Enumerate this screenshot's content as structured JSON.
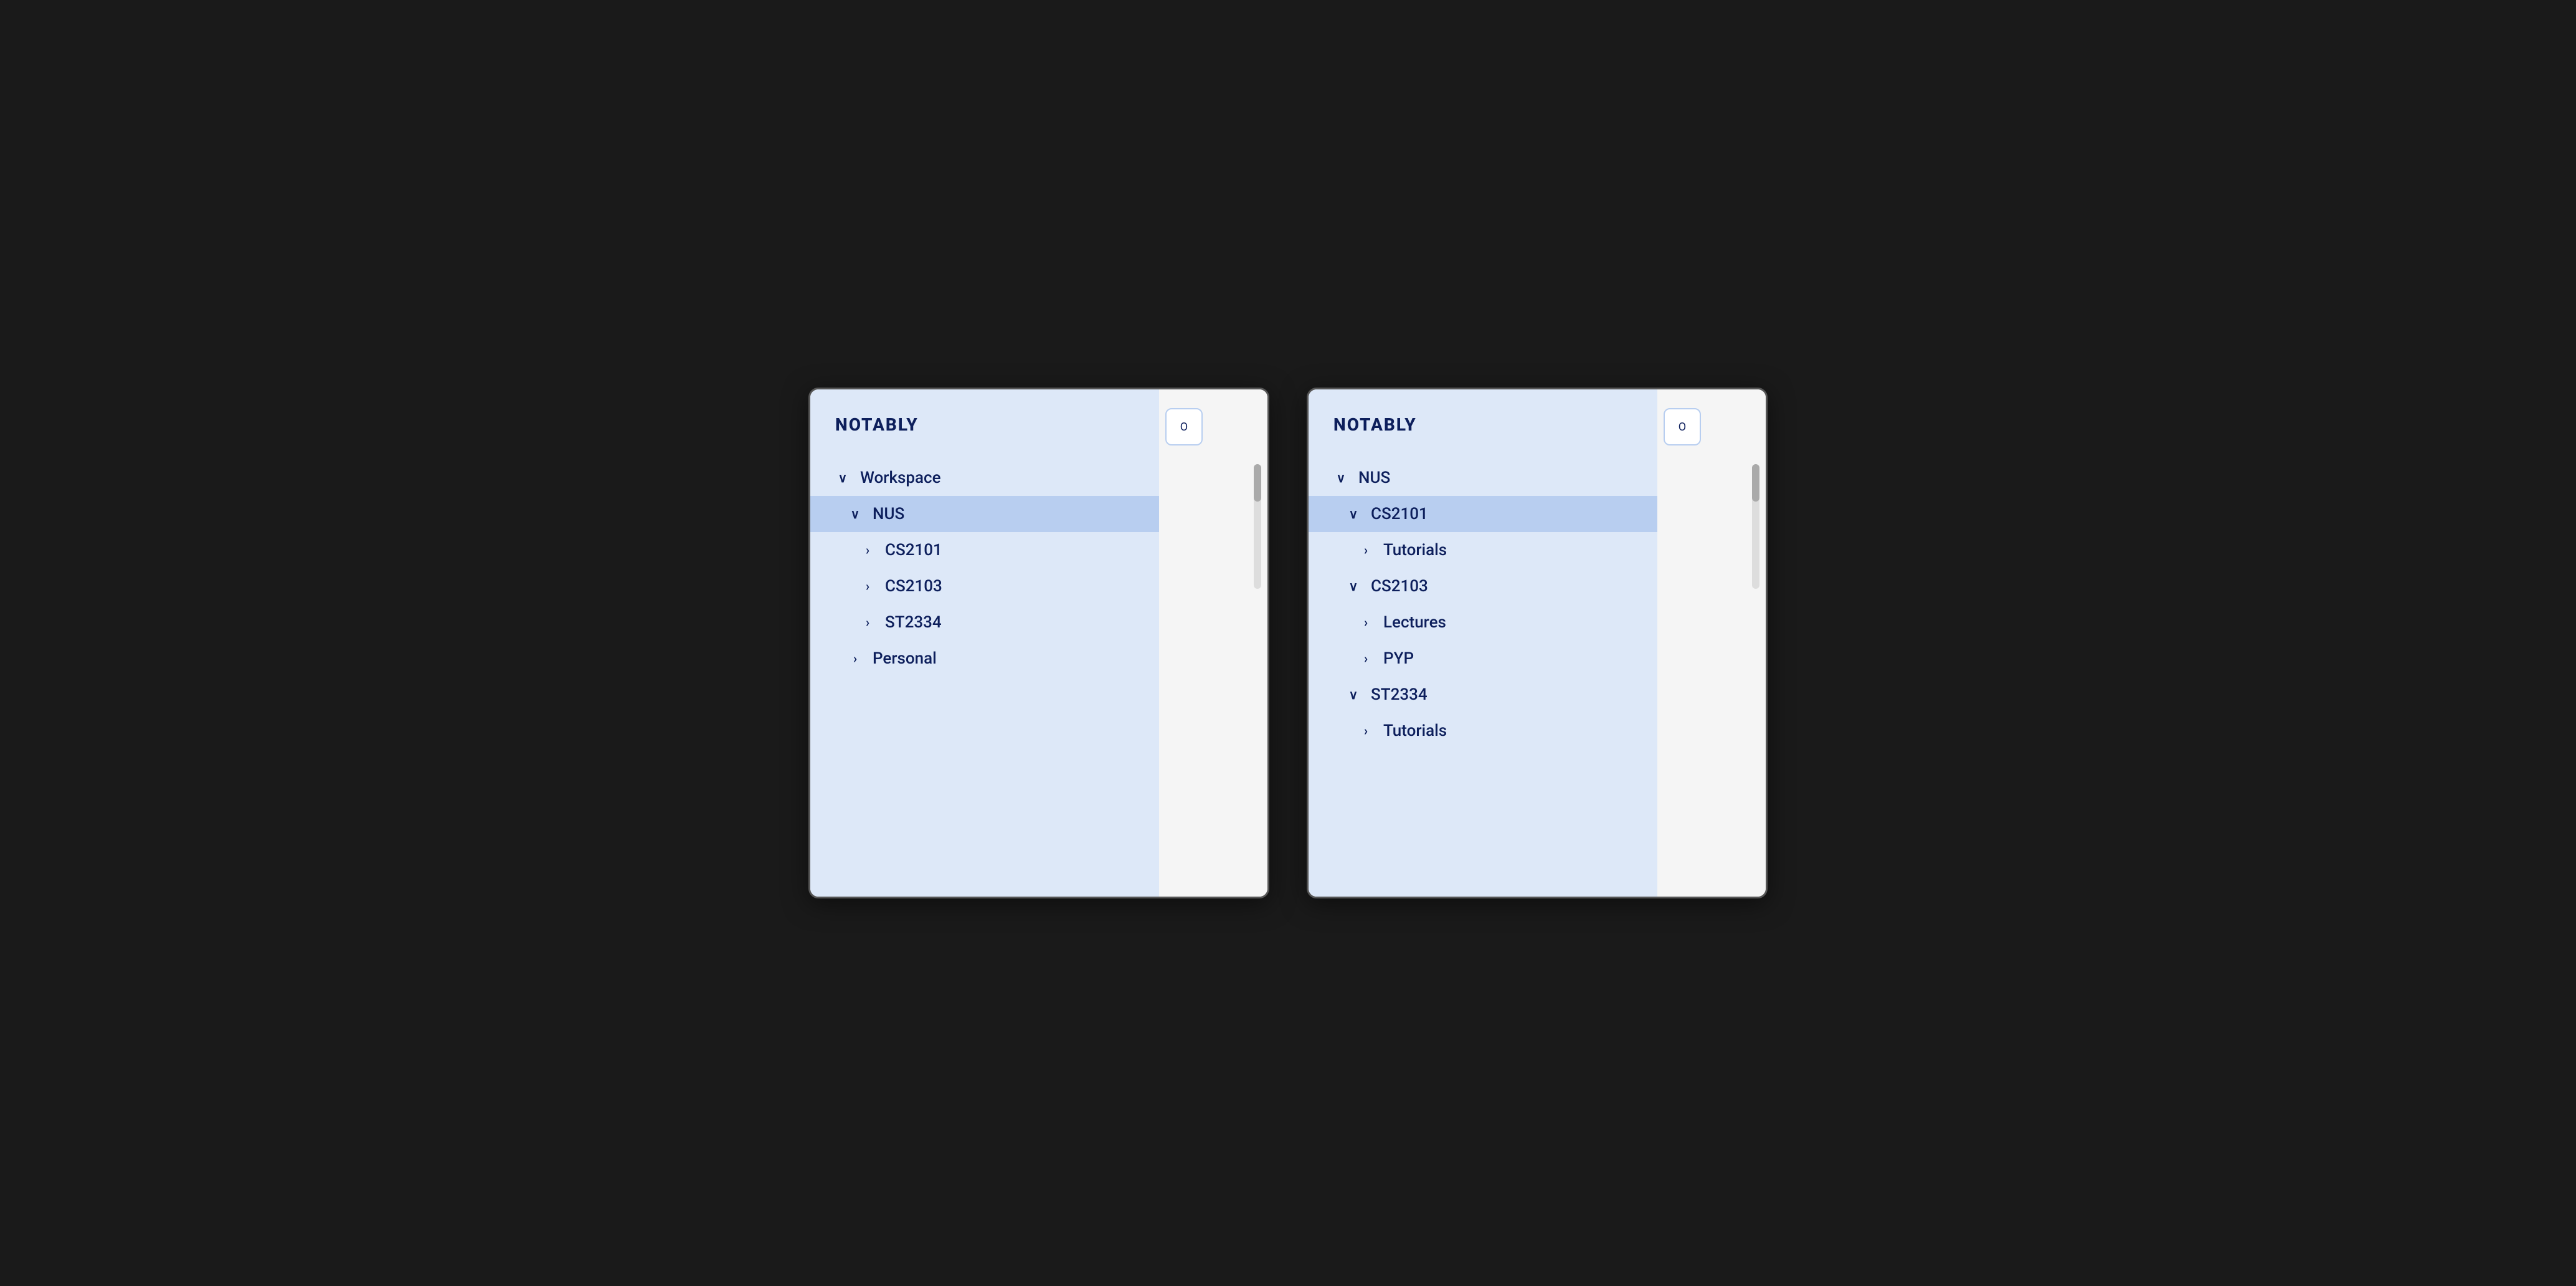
{
  "app": {
    "brand": "NOTABLY"
  },
  "panel_left": {
    "brand": "NOTABLY",
    "items": [
      {
        "id": "workspace",
        "label": "Workspace",
        "level": 0,
        "chevron": "∨",
        "active": false
      },
      {
        "id": "nus",
        "label": "NUS",
        "level": 1,
        "chevron": "∨",
        "active": true
      },
      {
        "id": "cs2101",
        "label": "CS2101",
        "level": 2,
        "chevron": "›",
        "active": false
      },
      {
        "id": "cs2103",
        "label": "CS2103",
        "level": 2,
        "chevron": "›",
        "active": false
      },
      {
        "id": "st2334",
        "label": "ST2334",
        "level": 2,
        "chevron": "›",
        "active": false
      },
      {
        "id": "personal",
        "label": "Personal",
        "level": 1,
        "chevron": "›",
        "active": false
      }
    ],
    "top_button_label": "O"
  },
  "panel_right": {
    "brand": "NOTABLY",
    "items": [
      {
        "id": "nus",
        "label": "NUS",
        "level": 0,
        "chevron": "∨",
        "active": false
      },
      {
        "id": "cs2101",
        "label": "CS2101",
        "level": 1,
        "chevron": "∨",
        "active": true
      },
      {
        "id": "tutorials-1",
        "label": "Tutorials",
        "level": 2,
        "chevron": "›",
        "active": false
      },
      {
        "id": "cs2103",
        "label": "CS2103",
        "level": 1,
        "chevron": "∨",
        "active": false
      },
      {
        "id": "lectures",
        "label": "Lectures",
        "level": 2,
        "chevron": "›",
        "active": false
      },
      {
        "id": "pyp",
        "label": "PYP",
        "level": 2,
        "chevron": "›",
        "active": false
      },
      {
        "id": "st2334",
        "label": "ST2334",
        "level": 1,
        "chevron": "∨",
        "active": false
      },
      {
        "id": "tutorials-2",
        "label": "Tutorials",
        "level": 2,
        "chevron": "›",
        "active": false
      }
    ],
    "top_button_label": "O"
  }
}
